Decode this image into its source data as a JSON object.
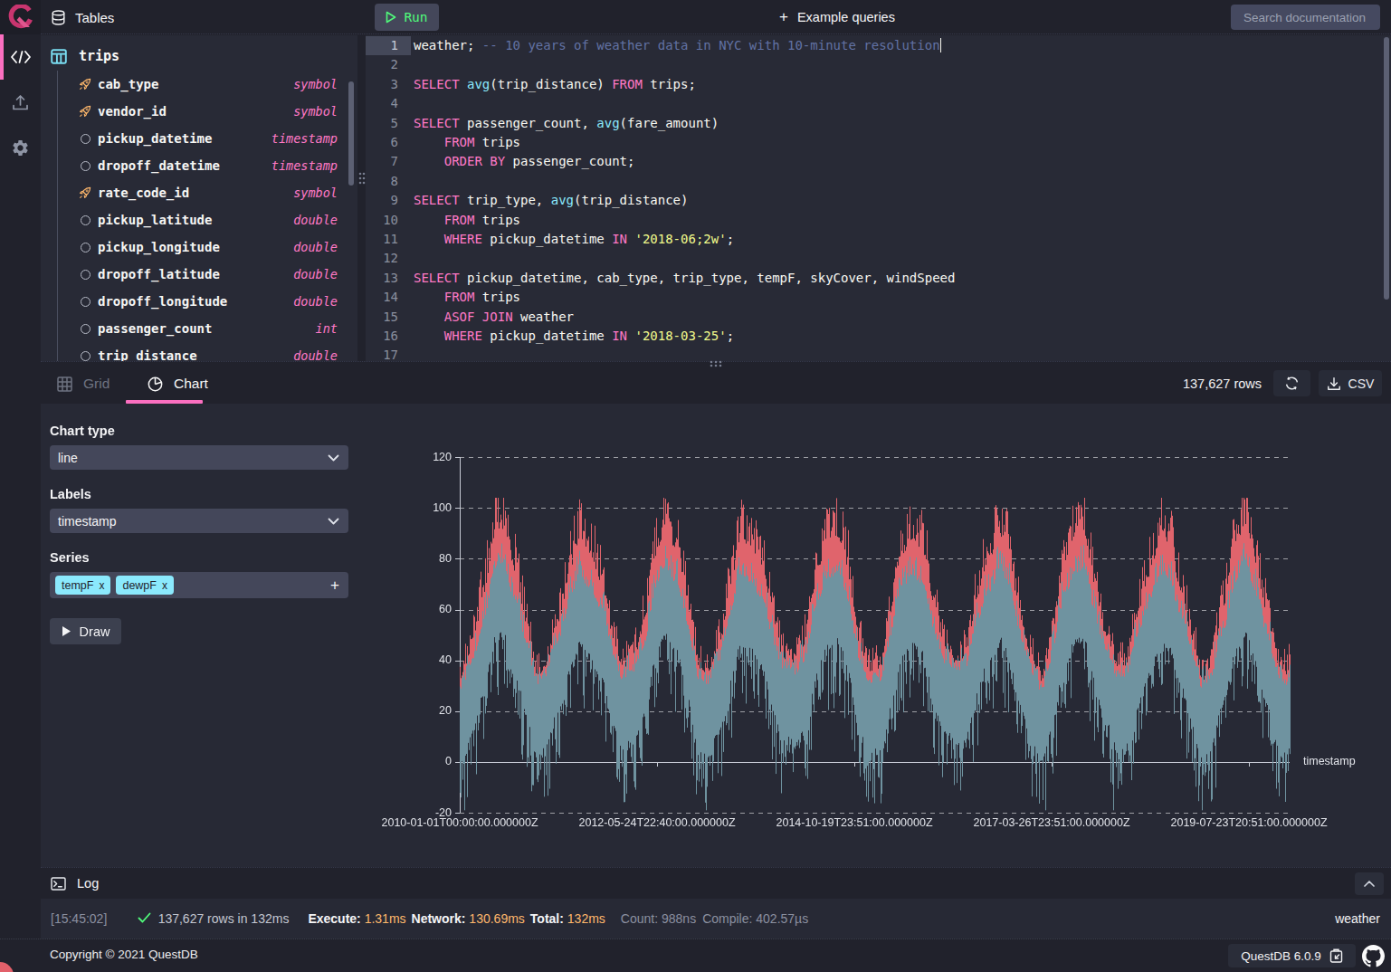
{
  "colors": {
    "accent_pink": "#fb6fc0",
    "syntax_keyword": "#ff79c6",
    "syntax_function": "#8be9fd",
    "syntax_string": "#f1fa8c",
    "syntax_comment": "#6272a4",
    "green": "#50fa7b",
    "orange": "#ffb86c",
    "series_tempF": "#e0646c",
    "series_dewpF": "#6f93a0"
  },
  "rail": {
    "items": [
      {
        "id": "console",
        "icon": "code-icon",
        "active": true
      },
      {
        "id": "import",
        "icon": "upload-icon",
        "active": false
      },
      {
        "id": "settings",
        "icon": "gear-icon",
        "active": false
      }
    ]
  },
  "toolbar": {
    "run_label": "Run",
    "example_queries_label": "Example queries",
    "search_placeholder": "Search documentation"
  },
  "tables_panel": {
    "header": "Tables",
    "table": {
      "name": "trips",
      "columns": [
        {
          "name": "cab_type",
          "type": "symbol",
          "indexed": true
        },
        {
          "name": "vendor_id",
          "type": "symbol",
          "indexed": true
        },
        {
          "name": "pickup_datetime",
          "type": "timestamp",
          "indexed": false
        },
        {
          "name": "dropoff_datetime",
          "type": "timestamp",
          "indexed": false
        },
        {
          "name": "rate_code_id",
          "type": "symbol",
          "indexed": true
        },
        {
          "name": "pickup_latitude",
          "type": "double",
          "indexed": false
        },
        {
          "name": "pickup_longitude",
          "type": "double",
          "indexed": false
        },
        {
          "name": "dropoff_latitude",
          "type": "double",
          "indexed": false
        },
        {
          "name": "dropoff_longitude",
          "type": "double",
          "indexed": false
        },
        {
          "name": "passenger_count",
          "type": "int",
          "indexed": false
        },
        {
          "name": "trip_distance",
          "type": "double",
          "indexed": false
        }
      ]
    }
  },
  "editor": {
    "active_line": 1,
    "lines": [
      {
        "n": 1,
        "tokens": [
          [
            "fg",
            "weather; "
          ],
          [
            "com",
            "-- 10 years of weather data in NYC with 10-minute resolution"
          ]
        ],
        "caret": true
      },
      {
        "n": 2,
        "tokens": []
      },
      {
        "n": 3,
        "tokens": [
          [
            "kw",
            "SELECT"
          ],
          [
            "fg",
            " "
          ],
          [
            "fn",
            "avg"
          ],
          [
            "fg",
            "(trip_distance) "
          ],
          [
            "kw",
            "FROM"
          ],
          [
            "fg",
            " trips;"
          ]
        ]
      },
      {
        "n": 4,
        "tokens": []
      },
      {
        "n": 5,
        "tokens": [
          [
            "kw",
            "SELECT"
          ],
          [
            "fg",
            " passenger_count, "
          ],
          [
            "fn",
            "avg"
          ],
          [
            "fg",
            "(fare_amount)"
          ]
        ]
      },
      {
        "n": 6,
        "tokens": [
          [
            "fg",
            "    "
          ],
          [
            "kw",
            "FROM"
          ],
          [
            "fg",
            " trips"
          ]
        ]
      },
      {
        "n": 7,
        "tokens": [
          [
            "fg",
            "    "
          ],
          [
            "kw",
            "ORDER BY"
          ],
          [
            "fg",
            " passenger_count;"
          ]
        ]
      },
      {
        "n": 8,
        "tokens": []
      },
      {
        "n": 9,
        "tokens": [
          [
            "kw",
            "SELECT"
          ],
          [
            "fg",
            " trip_type, "
          ],
          [
            "fn",
            "avg"
          ],
          [
            "fg",
            "(trip_distance)"
          ]
        ]
      },
      {
        "n": 10,
        "tokens": [
          [
            "fg",
            "    "
          ],
          [
            "kw",
            "FROM"
          ],
          [
            "fg",
            " trips"
          ]
        ]
      },
      {
        "n": 11,
        "tokens": [
          [
            "fg",
            "    "
          ],
          [
            "kw",
            "WHERE"
          ],
          [
            "fg",
            " pickup_datetime "
          ],
          [
            "kw",
            "IN"
          ],
          [
            "fg",
            " "
          ],
          [
            "str",
            "'2018-06;2w'"
          ],
          [
            "fg",
            ";"
          ]
        ]
      },
      {
        "n": 12,
        "tokens": []
      },
      {
        "n": 13,
        "tokens": [
          [
            "kw",
            "SELECT"
          ],
          [
            "fg",
            " pickup_datetime, cab_type, trip_type, tempF, skyCover, windSpeed"
          ]
        ]
      },
      {
        "n": 14,
        "tokens": [
          [
            "fg",
            "    "
          ],
          [
            "kw",
            "FROM"
          ],
          [
            "fg",
            " trips"
          ]
        ]
      },
      {
        "n": 15,
        "tokens": [
          [
            "fg",
            "    "
          ],
          [
            "kw",
            "ASOF JOIN"
          ],
          [
            "fg",
            " weather"
          ]
        ]
      },
      {
        "n": 16,
        "tokens": [
          [
            "fg",
            "    "
          ],
          [
            "kw",
            "WHERE"
          ],
          [
            "fg",
            " pickup_datetime "
          ],
          [
            "kw",
            "IN"
          ],
          [
            "fg",
            " "
          ],
          [
            "str",
            "'2018-03-25'"
          ],
          [
            "fg",
            ";"
          ]
        ]
      },
      {
        "n": 17,
        "tokens": []
      }
    ]
  },
  "results": {
    "tabs": [
      {
        "label": "Grid",
        "icon": "grid-icon",
        "active": false
      },
      {
        "label": "Chart",
        "icon": "pie-chart-icon",
        "active": true
      }
    ],
    "row_count": "137,627 rows",
    "csv_label": "CSV"
  },
  "chart_controls": {
    "chart_type_label": "Chart type",
    "chart_type_value": "line",
    "labels_label": "Labels",
    "labels_value": "timestamp",
    "series_label": "Series",
    "series_chips": [
      {
        "name": "tempF",
        "remove": "x"
      },
      {
        "name": "dewpF",
        "remove": "x"
      }
    ],
    "draw_label": "Draw"
  },
  "chart_data": {
    "type": "line",
    "x_axis_label": "timestamp",
    "y_ticks": [
      120,
      100,
      80,
      60,
      40,
      20,
      0,
      -20
    ],
    "ylim": [
      -20,
      120
    ],
    "x_tick_labels": [
      "2010-01-01T00:00:00.000000Z",
      "2012-05-24T22:40:00.000000Z",
      "2014-10-19T23:51:00.000000Z",
      "2017-03-26T23:51:00.000000Z",
      "2019-07-23T20:51:00.000000Z"
    ],
    "series": [
      {
        "name": "tempF",
        "color": "#e0646c",
        "mean": 56,
        "amplitude": 26,
        "summer_peak_approx": 100,
        "winter_low_approx": 25
      },
      {
        "name": "dewpF",
        "color": "#6f93a0",
        "mean": 40,
        "amplitude": 26,
        "summer_peak_approx": 75,
        "winter_low_approx": -15
      }
    ],
    "years_span": 10.05,
    "seed": 20210609,
    "legend": "off",
    "grid": "dashed"
  },
  "log": {
    "title": "Log",
    "entry": {
      "time": "[15:45:02]",
      "summary": "137,627 rows in 132ms",
      "execute_label": "Execute: ",
      "execute_value": "1.31ms",
      "network_label": "Network: ",
      "network_value": "130.69ms",
      "total_label": "Total: ",
      "total_value": "132ms",
      "count": "Count: 988ns",
      "compile": "Compile: 402.57µs"
    },
    "table_name": "weather"
  },
  "footer": {
    "copyright": "Copyright © 2021 QuestDB",
    "version": "QuestDB 6.0.9"
  }
}
